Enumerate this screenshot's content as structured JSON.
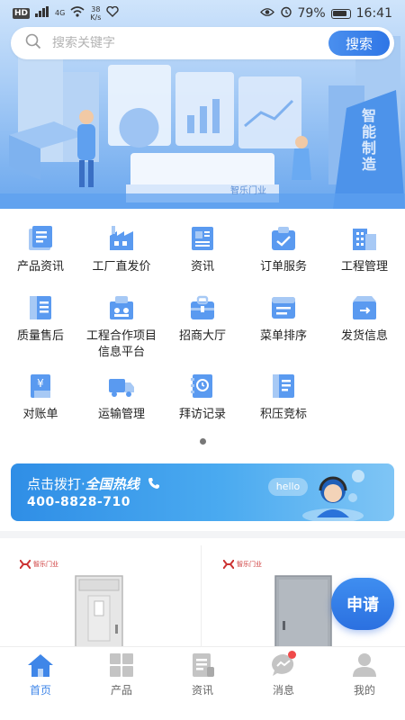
{
  "status_bar": {
    "hd": "HD",
    "network": "4G",
    "speed_value": "38",
    "speed_unit": "K/s",
    "battery": "79%",
    "time": "16:41"
  },
  "search": {
    "placeholder": "搜索关键字",
    "button_label": "搜索"
  },
  "hero": {
    "building_text": "智能制造",
    "brand_text": "智乐门业"
  },
  "grid": {
    "items": [
      {
        "label": "产品资讯",
        "icon": "product-info-icon"
      },
      {
        "label": "工厂直发价",
        "icon": "factory-icon"
      },
      {
        "label": "资讯",
        "icon": "news-icon"
      },
      {
        "label": "订单服务",
        "icon": "order-icon"
      },
      {
        "label": "工程管理",
        "icon": "building-icon"
      },
      {
        "label": "质量售后",
        "icon": "quality-icon"
      },
      {
        "label": "工程合作项目信息平台",
        "icon": "cooperation-icon"
      },
      {
        "label": "招商大厅",
        "icon": "briefcase-icon"
      },
      {
        "label": "菜单排序",
        "icon": "menu-sort-icon"
      },
      {
        "label": "发货信息",
        "icon": "shipping-box-icon"
      },
      {
        "label": "对账单",
        "icon": "statement-icon"
      },
      {
        "label": "运输管理",
        "icon": "truck-icon"
      },
      {
        "label": "拜访记录",
        "icon": "visit-record-icon"
      },
      {
        "label": "积压竞标",
        "icon": "bidding-icon"
      }
    ]
  },
  "hotline": {
    "prefix": "点击拨打·",
    "title": "全国热线",
    "phone": "400-8828-710",
    "hello": "hello"
  },
  "products": {
    "brand": "智乐门业"
  },
  "apply": {
    "label": "申请"
  },
  "bottom_nav": {
    "items": [
      {
        "label": "首页",
        "icon": "home-icon"
      },
      {
        "label": "产品",
        "icon": "grid-icon"
      },
      {
        "label": "资讯",
        "icon": "document-icon"
      },
      {
        "label": "消息",
        "icon": "chat-icon"
      },
      {
        "label": "我的",
        "icon": "person-icon"
      }
    ]
  },
  "colors": {
    "accent": "#3f86e8",
    "icon_blue": "#5a9af0",
    "badge": "#f04a4a"
  }
}
